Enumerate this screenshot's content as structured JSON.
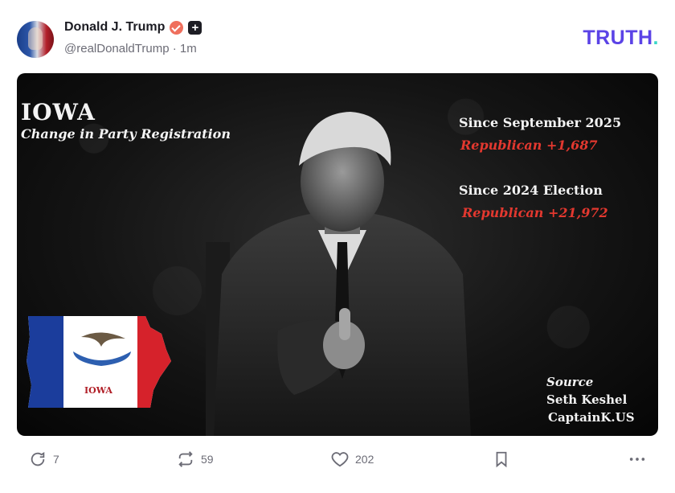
{
  "post": {
    "author_name": "Donald J. Trump",
    "handle_time": "@realDonaldTrump · 1m",
    "brand": {
      "main": "TRUTH",
      "dot": "."
    }
  },
  "image": {
    "title": "IOWA",
    "subtitle": "Change in Party Registration",
    "stat1_label": "Since September 2025",
    "stat1_value": "Republican +1,687",
    "stat2_label": "Since 2024 Election",
    "stat2_value": "Republican +21,972",
    "source_label": "Source",
    "source_name": "Seth Keshel",
    "source_handle": "CaptainK.US",
    "map_label": "IOWA"
  },
  "actions": {
    "replies": "7",
    "retruths": "59",
    "likes": "202"
  },
  "colors": {
    "brand": "#5b43e6",
    "brand_dot": "#39d7c9",
    "verified": "#ef6f5d",
    "highlight_red": "#e3382f"
  },
  "icons": [
    "reply-icon",
    "retruth-icon",
    "like-icon",
    "bookmark-icon",
    "more-icon",
    "verified-icon",
    "plus-icon"
  ]
}
